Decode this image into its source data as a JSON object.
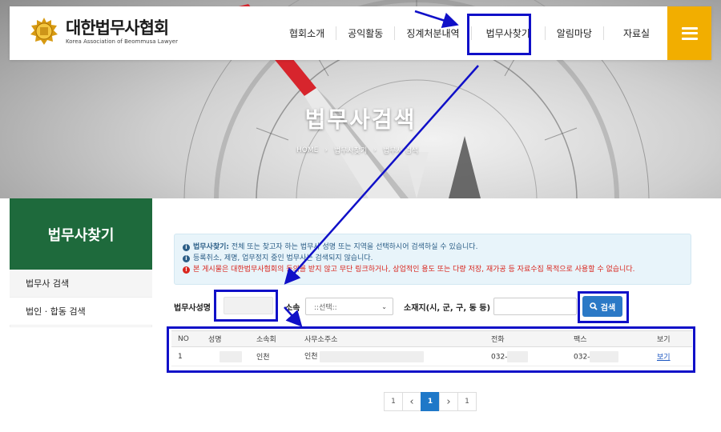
{
  "header": {
    "logo_name": "대한법무사협회",
    "logo_subtitle": "Korea Association of Beommusa Lawyer",
    "nav": [
      "협회소개",
      "공익활동",
      "징계처분내역",
      "법무사찾기",
      "알림마당",
      "자료실"
    ]
  },
  "hero": {
    "title": "법무사검색",
    "breadcrumb": [
      "HOME",
      "법무사찾기",
      "법무사 검색"
    ]
  },
  "sidebar": {
    "title": "법무사찾기",
    "items": [
      "법무사 검색",
      "법인 · 합동 검색"
    ]
  },
  "notice": {
    "line1_bold": "법무사찾기:",
    "line1": " 전체 또는 찾고자 하는 법무사 성명 또는 지역을 선택하시어 검색하실 수 있습니다.",
    "line2": "등록취소, 제명, 업무정지 중인 법무사는 검색되지 않습니다.",
    "line3": "본 게시물은 대한법무사협회의 동의를 받지 않고 무단 링크하거나, 상업적인 용도 또는 다량 저장, 재가공 등 자료수집 목적으로 사용할 수 없습니다."
  },
  "search": {
    "name_label": "법무사성명",
    "affil_label": "소속",
    "affil_selected": "::선택::",
    "region_label": "소재지(시, 군, 구, 동 등)",
    "button_label": "검색"
  },
  "table": {
    "headers": [
      "NO",
      "성명",
      "소속회",
      "사무소주소",
      "전화",
      "팩스",
      "보기"
    ],
    "rows": [
      {
        "no": "1",
        "affil": "인천",
        "addr": "인천",
        "phone": "032-",
        "fax": "032-",
        "view": "보기"
      }
    ]
  },
  "pagination": [
    "1",
    "‹",
    "1",
    "›",
    "1"
  ],
  "colors": {
    "brand_green": "#1e6a3c",
    "accent_gold": "#f2ae00",
    "button_blue": "#2b79c6",
    "annotation_blue": "#1010c8"
  }
}
